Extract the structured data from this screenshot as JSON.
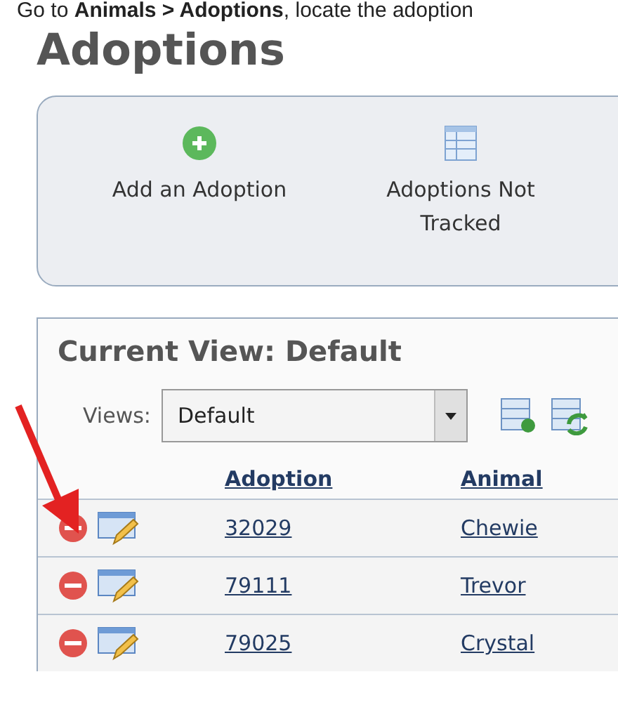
{
  "instruction": "Go to **Animals > Adoptions**, locate the adoption",
  "title": "Adoptions",
  "actions": [
    {
      "kind": "add",
      "label": "Add an Adoption"
    },
    {
      "kind": "table",
      "label": "Adoptions Not Tracked"
    }
  ],
  "view": {
    "heading": "Current View: Default",
    "views_label": "Views:",
    "views_value": "Default"
  },
  "table": {
    "columns": [
      "Adoption",
      "Animal"
    ],
    "rows": [
      {
        "adoption": "32029",
        "animal": "Chewie"
      },
      {
        "adoption": "79111",
        "animal": "Trevor"
      },
      {
        "adoption": "79025",
        "animal": "Crystal"
      }
    ]
  }
}
